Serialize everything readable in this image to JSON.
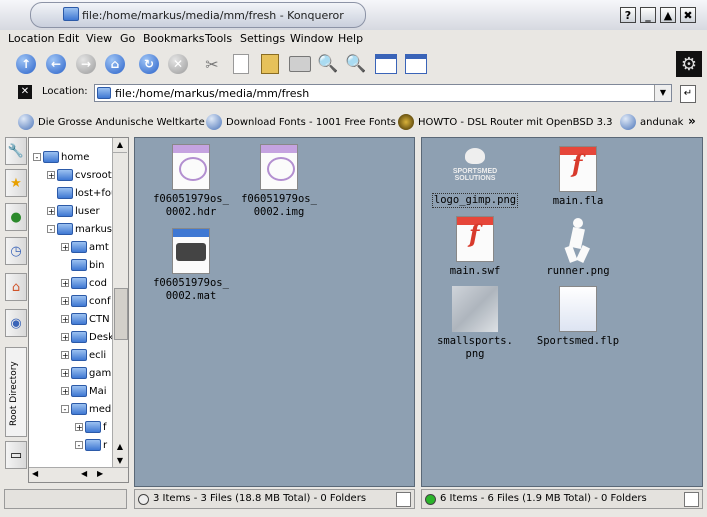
{
  "window": {
    "title": "file:/home/markus/media/mm/fresh - Konqueror",
    "buttons": [
      "?",
      "_",
      "▲",
      "✖"
    ]
  },
  "menu": [
    "Location",
    "Edit",
    "View",
    "Go",
    "Bookmarks",
    "Tools",
    "Settings",
    "Window",
    "Help"
  ],
  "location": {
    "label": "Location:",
    "value": "file:/home/markus/media/mm/fresh"
  },
  "bookmarks": [
    "Die Grosse Andunische Weltkarte",
    "Download Fonts - 1001 Free Fonts",
    "HOWTO - DSL Router mit OpenBSD 3.3",
    "andunak"
  ],
  "sidebar": {
    "root_tab": "Root Directory"
  },
  "tree": [
    {
      "label": "home",
      "expander": "-"
    },
    {
      "label": "cvsroot",
      "expander": "+"
    },
    {
      "label": "lost+fou",
      "expander": ""
    },
    {
      "label": "luser",
      "expander": "+"
    },
    {
      "label": "markus",
      "expander": "-"
    },
    {
      "label": "amt",
      "expander": "+"
    },
    {
      "label": "bin",
      "expander": ""
    },
    {
      "label": "cod",
      "expander": "+"
    },
    {
      "label": "conf",
      "expander": "+"
    },
    {
      "label": "CTN",
      "expander": "+"
    },
    {
      "label": "Desk",
      "expander": "+"
    },
    {
      "label": "ecli",
      "expander": "+"
    },
    {
      "label": "gam",
      "expander": "+"
    },
    {
      "label": "Mai",
      "expander": "+"
    },
    {
      "label": "med",
      "expander": "-"
    },
    {
      "label": "f",
      "expander": "+"
    },
    {
      "label": "r",
      "expander": "-"
    }
  ],
  "left_pane": {
    "files": [
      {
        "name": "f06051979os_\n0002.hdr",
        "type": "brain"
      },
      {
        "name": "f06051979os_\n0002.img",
        "type": "brain"
      },
      {
        "name": "f06051979os_\n0002.mat",
        "type": "mat"
      }
    ],
    "status": "3 Items - 3 Files (18.8 MB Total) - 0 Folders"
  },
  "right_pane": {
    "files": [
      {
        "name": "logo_gimp.png",
        "type": "logo",
        "logo_text": "SPORTSMED\nSOLUTIONS"
      },
      {
        "name": "main.fla",
        "type": "flash"
      },
      {
        "name": "main.swf",
        "type": "flash"
      },
      {
        "name": "runner.png",
        "type": "runner"
      },
      {
        "name": "smallsports.\npng",
        "type": "small"
      },
      {
        "name": "Sportsmed.flp",
        "type": "flp"
      }
    ],
    "status": "6 Items - 6 Files (1.9 MB Total) - 0 Folders"
  },
  "colors": {
    "pane_bg": "#8ea0b2",
    "led_active": "#2bb52b"
  }
}
